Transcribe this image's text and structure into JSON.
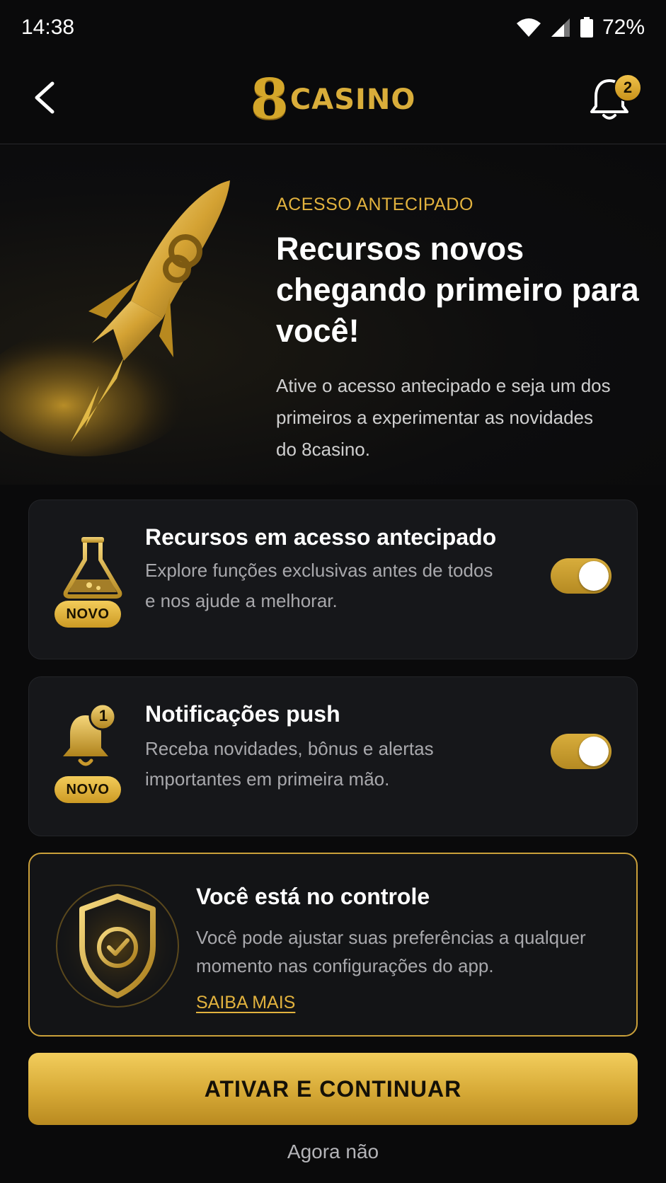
{
  "status_bar": {
    "time": "14:38",
    "battery": "72%"
  },
  "header": {
    "logo_number": "8",
    "logo_text": "CASINO",
    "notification_count": "2"
  },
  "hero": {
    "eyebrow": "ACESSO ANTECIPADO",
    "title": "Recursos novos chegando primeiro para você!",
    "description": "Ative o acesso antecipado e seja um dos primeiros a experimentar as novidades do 8casino."
  },
  "features": [
    {
      "badge": "NOVO",
      "title": "Recursos em acesso antecipado",
      "description": "Explore funções exclusivas antes de todos e nos ajude a melhorar.",
      "enabled": true,
      "icon": "flask-icon"
    },
    {
      "badge": "NOVO",
      "title": "Notificações push",
      "description": "Receba novidades, bônus e alertas importantes em primeira mão.",
      "enabled": true,
      "icon": "bell-icon",
      "icon_count": "1"
    }
  ],
  "control": {
    "title": "Você está no controle",
    "description": "Você pode ajustar suas preferências a qualquer momento nas configurações do app.",
    "link": "SAIBA MAIS"
  },
  "actions": {
    "primary": "ATIVAR E CONTINUAR",
    "secondary": "Agora não"
  },
  "colors": {
    "accent": "#d9ad3a",
    "background": "#0a0a0b",
    "card": "#16171a"
  }
}
